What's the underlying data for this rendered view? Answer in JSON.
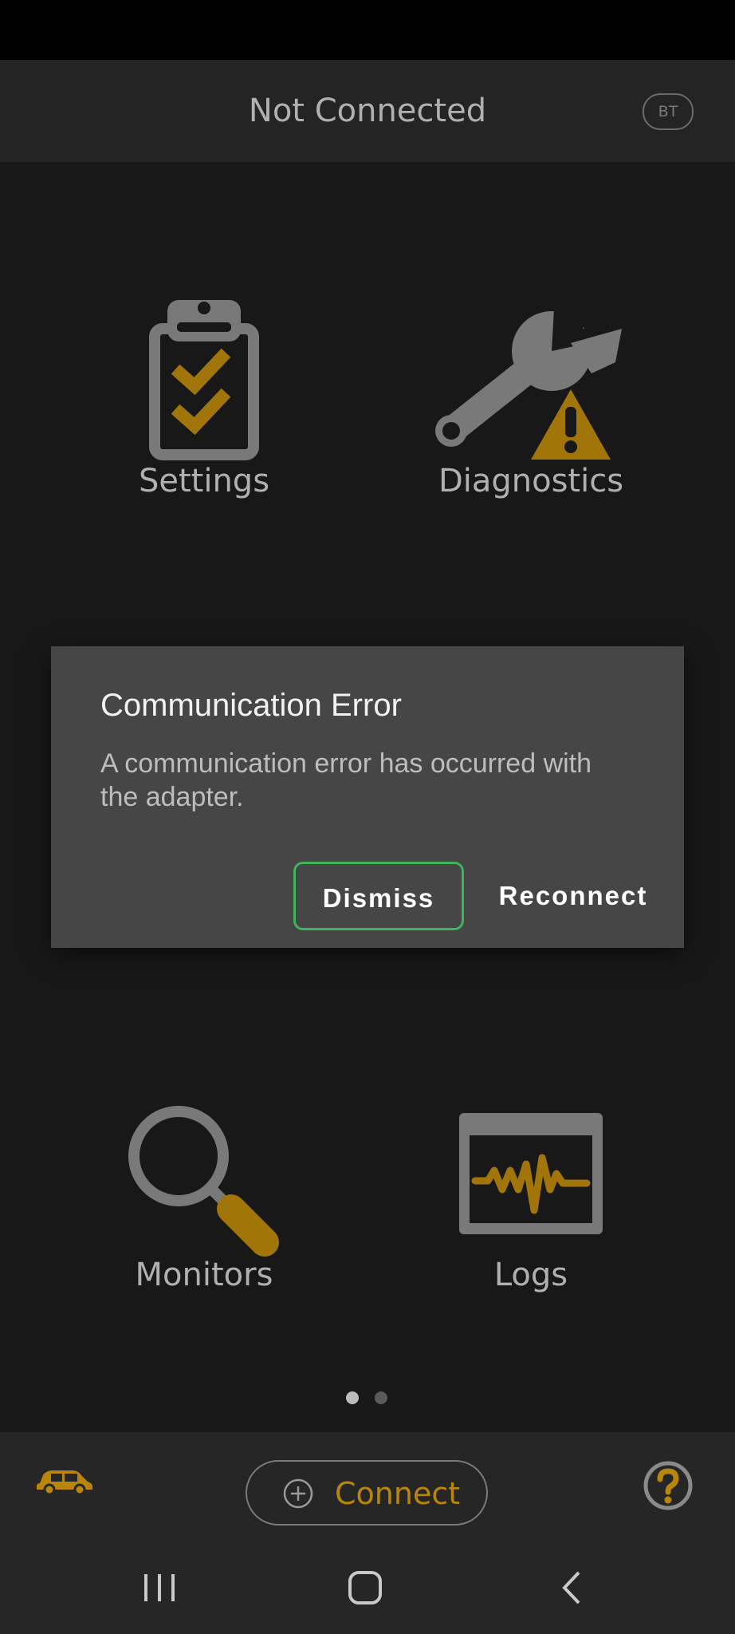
{
  "header": {
    "title": "Not Connected",
    "bt_badge": "BT"
  },
  "tiles": [
    {
      "label": "Settings",
      "icon": "clipboard-check-icon"
    },
    {
      "label": "Diagnostics",
      "icon": "wrench-warning-icon"
    },
    {
      "label": "Monitors",
      "icon": "magnifier-icon"
    },
    {
      "label": "Logs",
      "icon": "waveform-monitor-icon"
    }
  ],
  "dialog": {
    "title": "Communication Error",
    "message": "A communication error has occurred with the adapter.",
    "dismiss_label": "Dismiss",
    "reconnect_label": "Reconnect"
  },
  "pager": {
    "pages": 2,
    "current": 1
  },
  "bottom": {
    "connect_label": "Connect",
    "vehicle_icon": "car-icon",
    "help_icon": "help-icon"
  },
  "colors": {
    "accent": "#b8860b",
    "icon_gray": "#8a8a8a",
    "focus_border": "#3fb45a",
    "dialog_bg": "#464646"
  }
}
